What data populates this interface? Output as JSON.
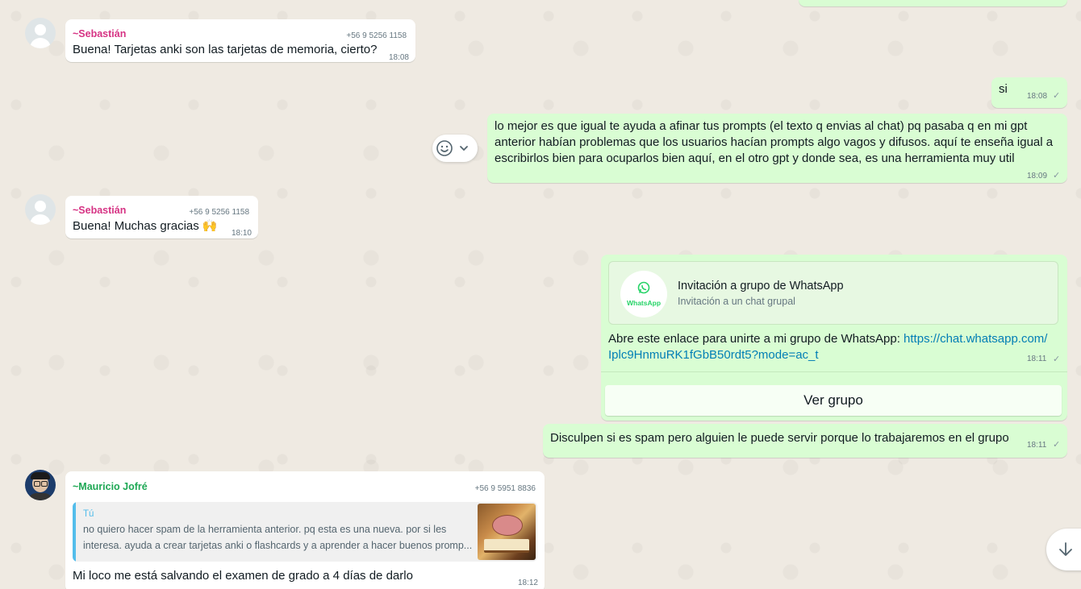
{
  "colors": {
    "chat_background": "#efeae2",
    "incoming_bubble": "#ffffff",
    "outgoing_bubble": "#d9fdd3",
    "sender_sebastian": "#d63384",
    "sender_mauricio": "#1fa855",
    "link": "#027eb5",
    "quote_author": "#53bdeb",
    "whatsapp_green": "#25d366"
  },
  "messages": {
    "m1": {
      "sender": "~Sebastián",
      "phone": "+56 9 5256 1158",
      "text": "Buena! Tarjetas anki son las tarjetas de memoria, cierto?",
      "time": "18:08"
    },
    "m2": {
      "text": "si",
      "time": "18:08",
      "status": "✓"
    },
    "m3": {
      "lines": [
        "lo mejor es que igual te ayuda a afinar tus prompts (el texto q envias al chat) pq pasaba q en mi gpt",
        "anterior habían problemas que los usuarios hacían prompts  algo vagos y difusos. aquí te enseña igual a",
        "escribirlos bien para ocuparlos bien aquí, en el otro gpt y donde sea, es una herramienta muy util"
      ],
      "time": "18:09",
      "status": "✓"
    },
    "m4": {
      "sender": "~Sebastián",
      "phone": "+56 9 5256 1158",
      "text": "Buena! Muchas gracias 🙌",
      "time": "18:10"
    },
    "m5": {
      "card_title": "Invitación a grupo de WhatsApp",
      "card_subtitle": "Invitación a un chat grupal",
      "logo_text": "WhatsApp",
      "text_prefix": "Abre este enlace para unirte a mi grupo de WhatsApp: ",
      "link_line1": "https://chat.whatsapp.com/",
      "link_line2": "Iplc9HnmuRK1fGbB50rdt5?mode=ac_t",
      "time": "18:11",
      "status": "✓",
      "button_label": "Ver grupo"
    },
    "m6": {
      "text": "Disculpen si es spam pero alguien le puede servir porque lo trabajaremos en el grupo",
      "time": "18:11",
      "status": "✓"
    },
    "m7": {
      "sender": "~Mauricio Jofré",
      "phone": "+56 9 5951 8836",
      "quote_author": "Tú",
      "quote_lines": [
        "no quiero hacer spam de la herramienta anterior. pq esta es una nueva. por si les",
        "interesa. ayuda a crear tarjetas anki o flashcards y a aprender a hacer buenos promp..."
      ],
      "text": "Mi loco me está salvando el examen de grado a 4 días de darlo",
      "time": "18:12"
    }
  },
  "icons": {
    "reaction": "smiley-icon",
    "reaction_menu": "chevron-down-icon",
    "scroll": "arrow-down-icon",
    "default_avatar": "person-icon"
  }
}
